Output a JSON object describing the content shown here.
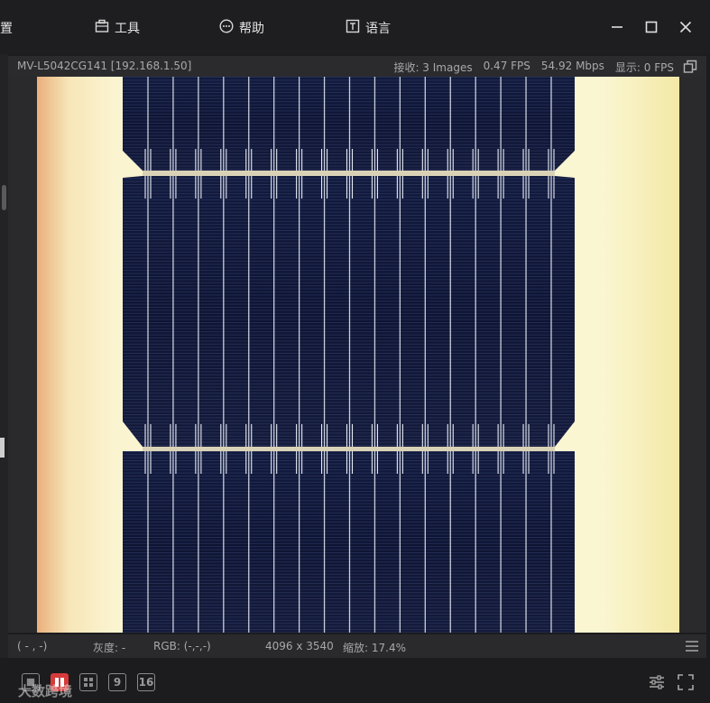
{
  "menu": {
    "partial_label": "置",
    "tools_label": "工具",
    "help_label": "帮助",
    "language_label": "语言"
  },
  "camera": {
    "name": "MV-L5042CG141 [192.168.1.50]",
    "received": "接收: 3 Images",
    "fps": "0.47 FPS",
    "bandwidth": "54.92 Mbps",
    "display": "显示: 0 FPS"
  },
  "status": {
    "coords": "( - , -)",
    "gray": "灰度: -",
    "rgb": "RGB: (-,-,-)",
    "resolution": "4096 x 3540",
    "zoom": "缩放: 17.4%"
  },
  "layout_buttons": [
    "",
    "",
    "",
    "9",
    "16"
  ],
  "watermark": "大数跨境",
  "colors": {
    "accent": "#d73a3a",
    "panel_dark": "#0f1535",
    "background_cream": "#f7f2c4"
  },
  "icons": [
    "tools-icon",
    "help-icon",
    "language-icon",
    "minimize-icon",
    "maximize-icon",
    "close-icon",
    "restore-icon",
    "settings-icon",
    "fullscreen-icon"
  ]
}
